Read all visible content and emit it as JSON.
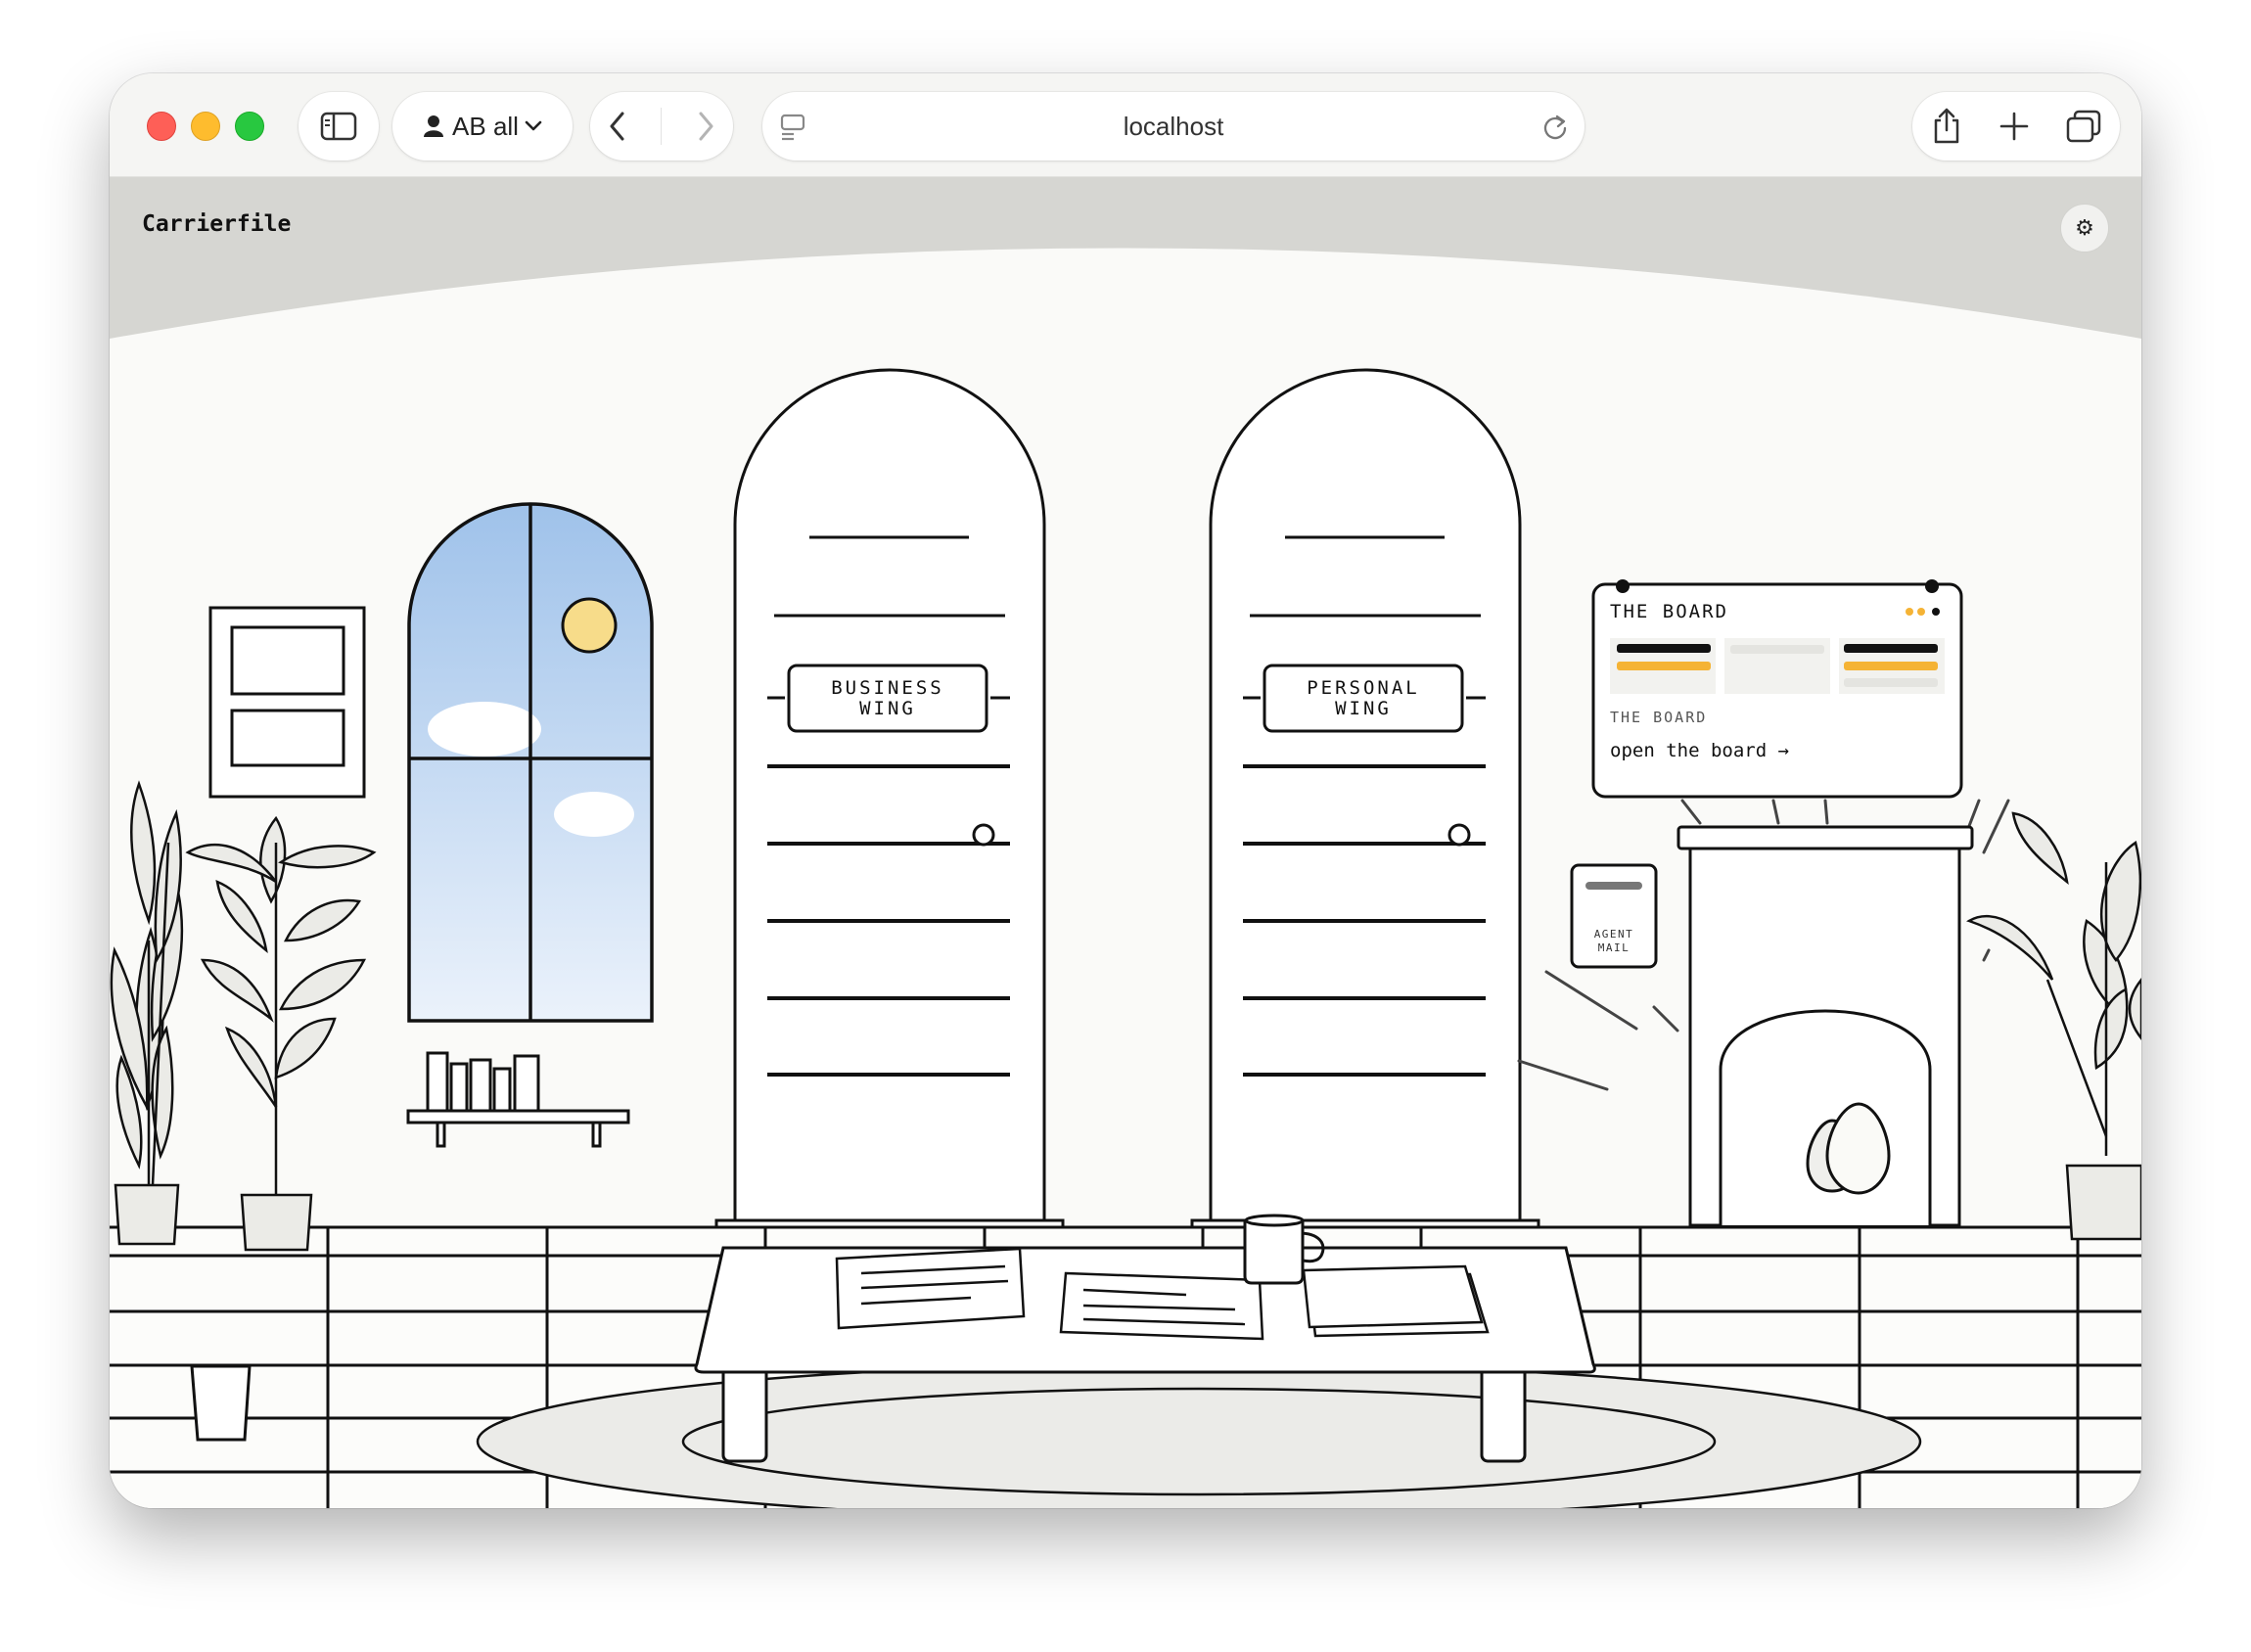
{
  "browser": {
    "profile_label": "AB all",
    "url": "localhost"
  },
  "app": {
    "title": "Carrierfile",
    "settings_icon": "⚙"
  },
  "doors": {
    "business_line1": "BUSINESS",
    "business_line2": "WING",
    "personal_line1": "PERSONAL",
    "personal_line2": "WING"
  },
  "board": {
    "header": "THE BOARD",
    "subtitle": "THE BOARD",
    "link": "open the board →"
  },
  "mailbox": {
    "line1": "AGENT",
    "line2": "MAIL"
  },
  "colors": {
    "accent": "#f5b335",
    "ink": "#111111",
    "wall": "#fafaf8",
    "sky_top": "#a4c6ec",
    "sun": "#f7dc8a"
  }
}
